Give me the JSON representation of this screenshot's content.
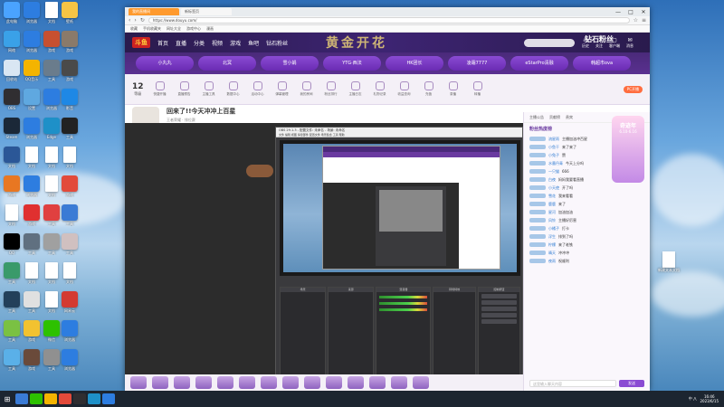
{
  "browser": {
    "tab_active": "我的直播间",
    "tab_inactive": "新标签页",
    "address": "https://www.douyu.com/",
    "bookmarks": [
      "收藏",
      "手机收藏夹",
      "网址大全",
      "游戏中心",
      "漫画"
    ],
    "win_min": "—",
    "win_max": "□",
    "win_close": "✕"
  },
  "site": {
    "logo": "斗鱼",
    "nav": [
      "首页",
      "直播",
      "分类",
      "视频",
      "游戏",
      "鱼吧",
      "钻石粉丝"
    ],
    "watermark": "黄金开花",
    "fan_title": "钻石粉丝",
    "search_placeholder": "",
    "header_icons": [
      {
        "glyph": "◴",
        "label": "历史"
      },
      {
        "glyph": "♡",
        "label": "关注"
      },
      {
        "glyph": "▢",
        "label": "客户端"
      },
      {
        "glyph": "✉",
        "label": "消息"
      }
    ]
  },
  "pills": [
    "小丸丸",
    "北冥",
    "雪小娟",
    "YTG·西法",
    "HK团长",
    "凌霜7777",
    "eStarPro清融",
    "韩超市ova"
  ],
  "actionbar": {
    "level": "12",
    "level_label": "等级",
    "actions": [
      "快捷开播",
      "直播预告",
      "主播工具",
      "数据中心",
      "活动中心",
      "弹幕管理",
      "我的房间",
      "粉丝排行",
      "主播日志",
      "礼物记录",
      "收益查询",
      "充值",
      "录播",
      "转播"
    ],
    "pc_badge": "PC开播"
  },
  "room": {
    "title": "回来了!!今天冲冲上百星",
    "sub": "王者荣耀  ·  排位赛",
    "buttons": [
      "分享",
      "关注主播",
      "粉丝团"
    ]
  },
  "obs": {
    "title": "OBS 29.1.3 - 配置文件: 未命名 - 场景: 未命名",
    "menu": "文件  编辑  视图  停靠部件  配置文件  场景集合  工具  帮助",
    "docks": [
      "场景",
      "来源",
      "混音器",
      "转场特效",
      "控制按钮"
    ]
  },
  "chat": {
    "head": [
      "主播公告",
      "贡献榜",
      "贵宾"
    ],
    "rank_label": "粉丝热度榜",
    "messages": [
      {
        "user": "流星雨",
        "text": "主播加油冲百星"
      },
      {
        "user": "小鱼干",
        "text": "来了来了"
      },
      {
        "user": "小兔子",
        "text": "赞"
      },
      {
        "user": "水墨丹青",
        "text": "今天上分吗"
      },
      {
        "user": "一只猫",
        "text": "666"
      },
      {
        "user": "白夜",
        "text": "妈妈我要看直播"
      },
      {
        "user": "小天使",
        "text": "开了吗"
      },
      {
        "user": "雪花",
        "text": "我来看看"
      },
      {
        "user": "鹿鹿",
        "text": "来了"
      },
      {
        "user": "星河",
        "text": "加油加油"
      },
      {
        "user": "风铃",
        "text": "主播好厉害"
      },
      {
        "user": "小橘子",
        "text": "打卡"
      },
      {
        "user": "浮生",
        "text": "排到了吗"
      },
      {
        "user": "柠檬",
        "text": "来了老铁"
      },
      {
        "user": "晴天",
        "text": "冲冲冲"
      },
      {
        "user": "夜雨",
        "text": "祝顺利"
      }
    ],
    "input_placeholder": "这里输入聊天内容",
    "send": "发送",
    "promo_title": "奇迹年",
    "promo_date": "6.10-6.16"
  },
  "desktop": {
    "file_label": "新建文本文档",
    "icons": [
      {
        "label": "此电脑",
        "color": "#4aa3ff"
      },
      {
        "label": "浏览器",
        "color": "#2d7de0"
      },
      {
        "label": "文档",
        "color": "#ffffff"
      },
      {
        "label": "壁纸",
        "color": "#f6c445"
      },
      {
        "label": "网络",
        "color": "#3aa1e8"
      },
      {
        "label": "浏览器",
        "color": "#2d7de0"
      },
      {
        "label": "游戏",
        "color": "#c75030"
      },
      {
        "label": "游戏",
        "color": "#8a7a6a"
      },
      {
        "label": "回收站",
        "color": "#d9e6f3"
      },
      {
        "label": "QQ音乐",
        "color": "#f4b400"
      },
      {
        "label": "工具",
        "color": "#6a7c8c"
      },
      {
        "label": "游戏",
        "color": "#4a4a4a"
      },
      {
        "label": "OBS",
        "color": "#302e31"
      },
      {
        "label": "设置",
        "color": "#5fa8e0"
      },
      {
        "label": "浏览器",
        "color": "#2d7de0"
      },
      {
        "label": "影音",
        "color": "#1e88e5"
      },
      {
        "label": "Steam",
        "color": "#1b2838"
      },
      {
        "label": "浏览器",
        "color": "#2d7de0"
      },
      {
        "label": "Edge",
        "color": "#1e90c8"
      },
      {
        "label": "工具",
        "color": "#222222"
      },
      {
        "label": "文档",
        "color": "#2b5797"
      },
      {
        "label": "文档",
        "color": "#ffffff"
      },
      {
        "label": "文档",
        "color": "#ffffff"
      },
      {
        "label": "文档",
        "color": "#ffffff"
      },
      {
        "label": "游戏",
        "color": "#e87722"
      },
      {
        "label": "浏览器",
        "color": "#2d7de0"
      },
      {
        "label": "文档",
        "color": "#ffffff"
      },
      {
        "label": "游戏",
        "color": "#e24a3a"
      },
      {
        "label": "文档",
        "color": "#ffffff"
      },
      {
        "label": "游戏",
        "color": "#e03030"
      },
      {
        "label": "工具",
        "color": "#e04040"
      },
      {
        "label": "工具",
        "color": "#3a7bd5"
      },
      {
        "label": "QQ",
        "color": "#000000"
      },
      {
        "label": "工具",
        "color": "#607080"
      },
      {
        "label": "工具",
        "color": "#a0a0a0"
      },
      {
        "label": "工具",
        "color": "#d0c0c0"
      },
      {
        "label": "工具",
        "color": "#3a9a6a"
      },
      {
        "label": "文档",
        "color": "#ffffff"
      },
      {
        "label": "文档",
        "color": "#ffffff"
      },
      {
        "label": "文档",
        "color": "#ffffff"
      },
      {
        "label": "工具",
        "color": "#23405a"
      },
      {
        "label": "工具",
        "color": "#e0e0e0"
      },
      {
        "label": "文档",
        "color": "#ffffff"
      },
      {
        "label": "网易云",
        "color": "#d33a31"
      },
      {
        "label": "工具",
        "color": "#7ac143"
      },
      {
        "label": "游戏",
        "color": "#f2c230"
      },
      {
        "label": "微信",
        "color": "#2dc100"
      },
      {
        "label": "浏览器",
        "color": "#2d7de0"
      },
      {
        "label": "工具",
        "color": "#5ab0e8"
      },
      {
        "label": "游戏",
        "color": "#6a4a3a"
      },
      {
        "label": "工具",
        "color": "#909090"
      },
      {
        "label": "浏览器",
        "color": "#2d7de0"
      }
    ]
  },
  "taskbar": {
    "start": "⊞",
    "apps": [
      "#3a7bd5",
      "#2dc100",
      "#f4b400",
      "#e24a3a",
      "#302e31",
      "#1e90c8",
      "#2d7de0"
    ],
    "tray_text": "中 ⋀",
    "time": "16:46",
    "date": "2023/6/15"
  }
}
